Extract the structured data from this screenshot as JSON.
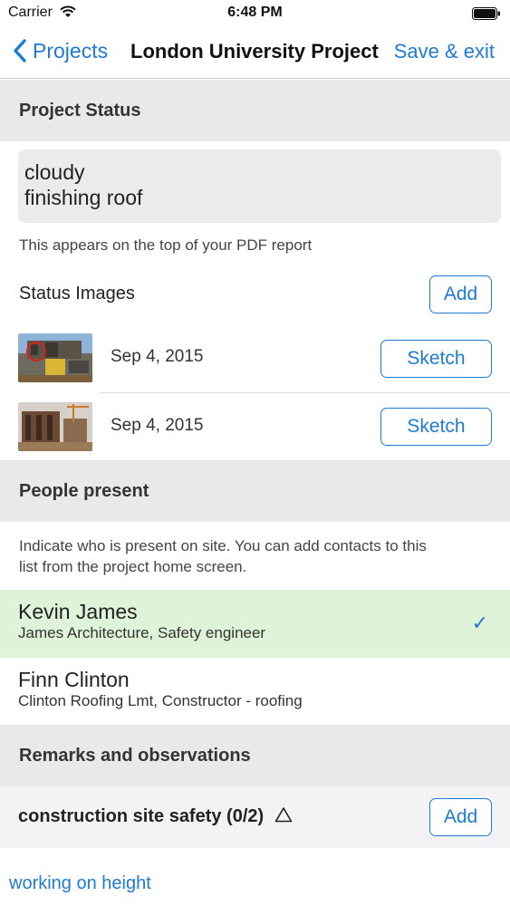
{
  "status_bar": {
    "carrier": "Carrier",
    "time": "6:48 PM"
  },
  "nav": {
    "back_label": "Projects",
    "title": "London University Project",
    "save_label": "Save & exit"
  },
  "project_status": {
    "header": "Project Status",
    "line1": "cloudy",
    "line2": "finishing roof",
    "hint": "This appears on the top of your PDF report"
  },
  "status_images": {
    "label": "Status Images",
    "add_label": "Add",
    "items": [
      {
        "date": "Sep 4, 2015",
        "sketch_label": "Sketch"
      },
      {
        "date": "Sep 4, 2015",
        "sketch_label": "Sketch"
      }
    ]
  },
  "people": {
    "header": "People present",
    "hint_line1": "Indicate who is present on site. You can add contacts to this",
    "hint_line2": "list from the project home screen.",
    "list": [
      {
        "name": "Kevin James",
        "role": "James Architecture, Safety engineer",
        "selected": true,
        "check": "✓"
      },
      {
        "name": "Finn Clinton",
        "role": "Clinton Roofing Lmt, Constructor - roofing",
        "selected": false
      }
    ]
  },
  "remarks": {
    "header": "Remarks and observations",
    "category_label": "construction site safety (0/2)",
    "category_icon": "triangle-warning-icon",
    "add_label": "Add",
    "item_link": "working on height"
  },
  "colors": {
    "accent": "#1d7bd6",
    "section_bg": "#e9e9ec",
    "selected_bg": "#dff3d8"
  }
}
